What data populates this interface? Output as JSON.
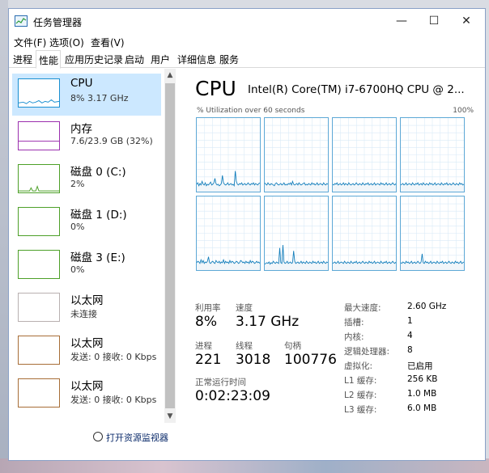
{
  "window": {
    "title": "任务管理器",
    "controls": {
      "minimize": "—",
      "maximize": "☐",
      "close": "✕"
    }
  },
  "menu": [
    "文件(F)",
    "选项(O)",
    "查看(V)"
  ],
  "tabs": [
    "进程",
    "性能",
    "应用历史记录",
    "启动",
    "用户",
    "详细信息",
    "服务"
  ],
  "active_tab": "性能",
  "sidebar": {
    "items": [
      {
        "name": "CPU",
        "sub": "8% 3.17 GHz",
        "color": "#1a8fd1"
      },
      {
        "name": "内存",
        "sub": "7.6/23.9 GB (32%)",
        "color": "#9b2fae"
      },
      {
        "name": "磁盘 0 (C:)",
        "sub": "2%",
        "color": "#4da028"
      },
      {
        "name": "磁盘 1 (D:)",
        "sub": "0%",
        "color": "#4da028"
      },
      {
        "name": "磁盘 3 (E:)",
        "sub": "0%",
        "color": "#4da028"
      },
      {
        "name": "以太网",
        "sub": "未连接",
        "color": "#b8b0b0"
      },
      {
        "name": "以太网",
        "sub": "发送: 0 接收: 0 Kbps",
        "color": "#a76d36"
      },
      {
        "name": "以太网",
        "sub": "发送: 0 接收: 0 Kbps",
        "color": "#a76d36"
      }
    ]
  },
  "resource_monitor": "打开资源监视器",
  "main": {
    "title": "CPU",
    "cpu_model": "Intel(R) Core(TM) i7-6700HQ CPU @ 2...",
    "util_label": "% Utilization over 60 seconds",
    "util_max": "100%",
    "graph_color": "#117dbb",
    "stats": {
      "utilization_label": "利用率",
      "utilization": "8%",
      "speed_label": "速度",
      "speed": "3.17 GHz",
      "processes_label": "进程",
      "processes": "221",
      "threads_label": "线程",
      "threads": "3018",
      "handles_label": "句柄",
      "handles": "100776",
      "uptime_label": "正常运行时间",
      "uptime": "0:02:23:09"
    },
    "specs": [
      {
        "label": "最大速度:",
        "value": "2.60 GHz"
      },
      {
        "label": "插槽:",
        "value": "1"
      },
      {
        "label": "内核:",
        "value": "4"
      },
      {
        "label": "逻辑处理器:",
        "value": "8"
      },
      {
        "label": "虚拟化:",
        "value": "已启用"
      },
      {
        "label": "L1 缓存:",
        "value": "256 KB"
      },
      {
        "label": "L2 缓存:",
        "value": "1.0 MB"
      },
      {
        "label": "L3 缓存:",
        "value": "6.0 MB"
      }
    ]
  },
  "core_history": [
    [
      10,
      12,
      8,
      11,
      9,
      14,
      10,
      9,
      12,
      8,
      10,
      9,
      11,
      13,
      9,
      10,
      12,
      18,
      11,
      9,
      10,
      8,
      9,
      11,
      22,
      12,
      10,
      9,
      10,
      12,
      9,
      10,
      11,
      9,
      10,
      8,
      28,
      14,
      10,
      9,
      11,
      10,
      12,
      9,
      10,
      11,
      9,
      10,
      12,
      10,
      9,
      11,
      10,
      12,
      9,
      11,
      10,
      9,
      11,
      12
    ],
    [
      12,
      10,
      9,
      12,
      10,
      9,
      11,
      10,
      9,
      8,
      11,
      12,
      10,
      9,
      10,
      11,
      9,
      10,
      12,
      9,
      10,
      9,
      11,
      10,
      12,
      9,
      14,
      10,
      9,
      10,
      11,
      9,
      12,
      10,
      9,
      10,
      11,
      12,
      9,
      10,
      9,
      11,
      10,
      9,
      12,
      10,
      11,
      9,
      10,
      12,
      9,
      10,
      11,
      10,
      9,
      12,
      10,
      9,
      11,
      10
    ],
    [
      10,
      9,
      11,
      10,
      12,
      9,
      10,
      11,
      9,
      10,
      12,
      9,
      11,
      10,
      9,
      12,
      10,
      9,
      10,
      11,
      9,
      10,
      12,
      10,
      9,
      11,
      10,
      9,
      12,
      10,
      9,
      11,
      10,
      12,
      9,
      10,
      11,
      9,
      10,
      12,
      9,
      10,
      11,
      10,
      9,
      12,
      10,
      11,
      9,
      10,
      12,
      9,
      10,
      11,
      9,
      10,
      12,
      10,
      9,
      11
    ],
    [
      9,
      10,
      11,
      9,
      10,
      12,
      9,
      10,
      11,
      10,
      9,
      12,
      10,
      9,
      11,
      10,
      12,
      9,
      10,
      11,
      9,
      12,
      10,
      9,
      11,
      10,
      9,
      12,
      10,
      11,
      9,
      10,
      12,
      9,
      10,
      11,
      10,
      9,
      12,
      10,
      9,
      11,
      10,
      12,
      9,
      10,
      11,
      9,
      10,
      12,
      10,
      9,
      11,
      10,
      9,
      12,
      10,
      11,
      9,
      10
    ],
    [
      10,
      12,
      11,
      9,
      14,
      10,
      13,
      9,
      11,
      10,
      12,
      18,
      10,
      9,
      11,
      12,
      10,
      9,
      13,
      11,
      10,
      12,
      9,
      11,
      10,
      14,
      9,
      12,
      10,
      11,
      9,
      13,
      10,
      12,
      11,
      9,
      10,
      12,
      11,
      9,
      10,
      13,
      12,
      10,
      11,
      9,
      12,
      10,
      11,
      9,
      13,
      10,
      12,
      11,
      9,
      10,
      12,
      10,
      11,
      9
    ],
    [
      8,
      9,
      10,
      9,
      11,
      8,
      10,
      9,
      12,
      10,
      9,
      11,
      10,
      9,
      30,
      10,
      9,
      34,
      11,
      9,
      10,
      12,
      9,
      10,
      11,
      9,
      10,
      26,
      12,
      9,
      10,
      11,
      9,
      10,
      12,
      9,
      11,
      10,
      9,
      12,
      10,
      9,
      11,
      10,
      9,
      12,
      10,
      11,
      9,
      10,
      12,
      9,
      10,
      11,
      9,
      12,
      10,
      9,
      11,
      10
    ],
    [
      9,
      10,
      11,
      9,
      10,
      12,
      9,
      10,
      11,
      10,
      9,
      12,
      10,
      9,
      11,
      10,
      9,
      12,
      10,
      9,
      11,
      10,
      12,
      9,
      10,
      11,
      9,
      10,
      12,
      10,
      9,
      11,
      10,
      9,
      12,
      10,
      11,
      9,
      10,
      12,
      9,
      10,
      11,
      10,
      9,
      12,
      10,
      9,
      11,
      10,
      12,
      9,
      10,
      11,
      9,
      10,
      12,
      10,
      9,
      11
    ],
    [
      10,
      9,
      11,
      10,
      9,
      12,
      10,
      11,
      9,
      10,
      12,
      9,
      10,
      11,
      9,
      10,
      12,
      10,
      9,
      11,
      22,
      10,
      9,
      12,
      10,
      11,
      9,
      10,
      12,
      9,
      10,
      11,
      10,
      9,
      12,
      10,
      9,
      11,
      10,
      12,
      9,
      10,
      11,
      9,
      10,
      12,
      10,
      9,
      11,
      10,
      9,
      12,
      10,
      11,
      9,
      10,
      12,
      9,
      10,
      11
    ]
  ]
}
